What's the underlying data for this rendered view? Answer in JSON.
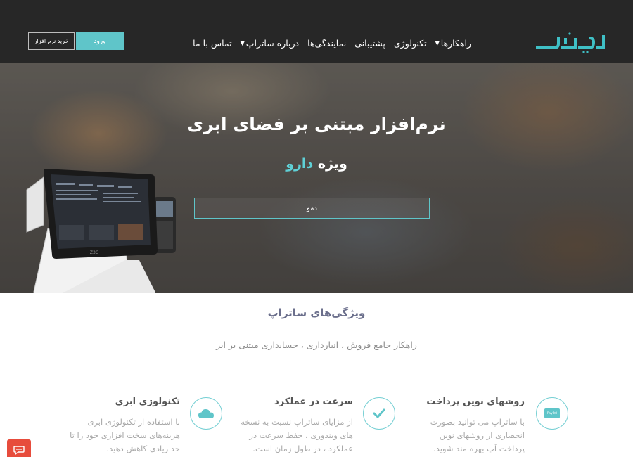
{
  "header": {
    "logo_text": "ساتراپ",
    "nav": [
      {
        "label": "راهکارها",
        "dropdown": true
      },
      {
        "label": "تکنولوژی",
        "dropdown": false
      },
      {
        "label": "پشتیبانی",
        "dropdown": false
      },
      {
        "label": "نمایندگی‌ها",
        "dropdown": false
      },
      {
        "label": "درباره ساتراپ",
        "dropdown": true
      },
      {
        "label": "تماس با ما",
        "dropdown": false
      }
    ],
    "login_label": "ورود",
    "buy_label": "خرید نرم افزار"
  },
  "hero": {
    "title": "نرم‌افزار مبتنی بر فضای ابری",
    "subtitle_prefix": "ویژه",
    "subtitle_accent": "دارو",
    "demo_label": "دمو"
  },
  "features_section": {
    "title": "ویژگی‌های ساتراپ",
    "subtitle": "راهکار جامع فروش ، انبارداری ، حسابداری مبتنی بر ابر",
    "items": [
      {
        "title": "روشهای نوین پرداخت",
        "icon": "paypal-icon",
        "icon_text": "PayPal",
        "lines": [
          "با ساتراپ می توانید بصورت",
          "انحصاری از روشهای نوین",
          "پرداخت آپ بهره مند شوید."
        ]
      },
      {
        "title": "سرعت در عملکرد",
        "icon": "check-icon",
        "lines": [
          "از مزایای ساتراپ نسبت به نسخه",
          "های ویندوزی ، حفظ سرعت در",
          "عملکرد ، در طول زمان است."
        ]
      },
      {
        "title": "تکنولوژی ابری",
        "icon": "cloud-icon",
        "lines": [
          "با استفاده از تکنولوژی ابری",
          "هزینه‌های سخت افزاری خود را تا",
          "حد زیادی کاهش دهید."
        ]
      }
    ]
  },
  "colors": {
    "header_bg": "#272727",
    "accent": "#5fc5c9",
    "title_color": "#6b6f8c",
    "chat_button": "#e74c3c"
  }
}
